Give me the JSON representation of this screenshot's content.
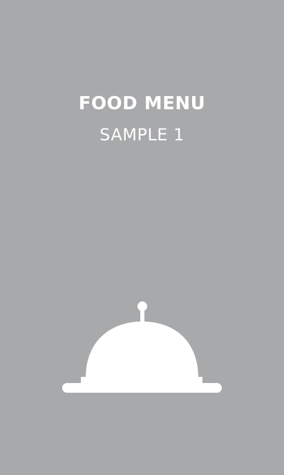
{
  "card": {
    "title": "FOOD MENU",
    "subtitle": "SAMPLE 1",
    "background_color": "#a8a9ab",
    "text_color": "#ffffff",
    "icon": "cloche-icon"
  }
}
